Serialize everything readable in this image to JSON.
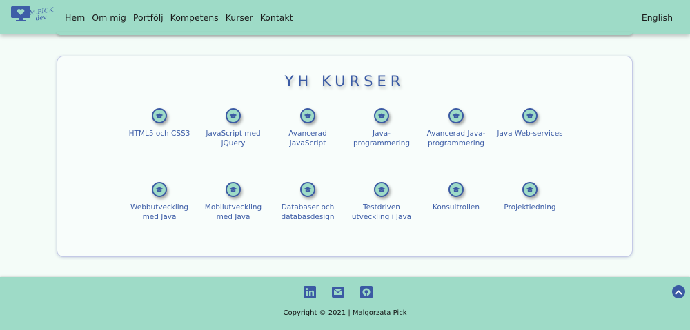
{
  "header": {
    "logo_line1": "M.PICK",
    "logo_line2": "dev",
    "menu": [
      "Hem",
      "Om mig",
      "Portfölj",
      "Kompetens",
      "Kurser",
      "Kontakt"
    ],
    "language": "English"
  },
  "section": {
    "title": "YH KURSER",
    "courses_row1": [
      "HTML5 och CSS3",
      "JavaScript med jQuery",
      "Avancerad JavaScript",
      "Java-programmering",
      "Avancerad Java-programmering",
      "Java Web-services"
    ],
    "courses_row2": [
      "Webbutveckling med Java",
      "Mobilutveckling med Java",
      "Databaser och databasdesign",
      "Testdriven utveckling i Java",
      "Konsultrollen",
      "Projektledning"
    ]
  },
  "footer": {
    "social": [
      "linkedin-icon",
      "email-icon",
      "github-icon"
    ],
    "copyright": "Copyright © 2021 | Malgorzata Pick"
  },
  "colors": {
    "mint": "#9edbc7",
    "accent_blue": "#3b5aa3",
    "page_bg": "#f4fcf8"
  }
}
